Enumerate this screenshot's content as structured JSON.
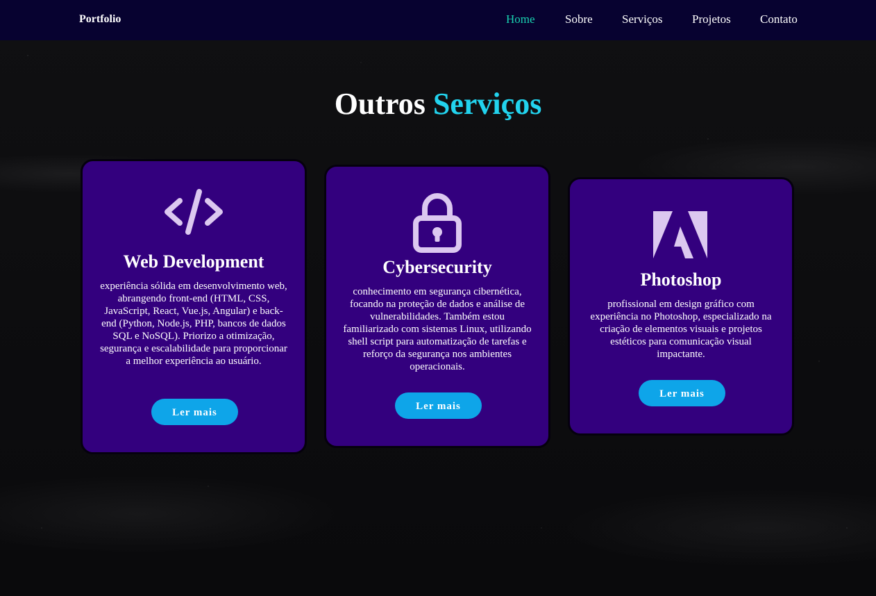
{
  "nav": {
    "logo": "Portfolio",
    "links": [
      {
        "label": "Home",
        "active": true
      },
      {
        "label": "Sobre",
        "active": false
      },
      {
        "label": "Serviços",
        "active": false
      },
      {
        "label": "Projetos",
        "active": false
      },
      {
        "label": "Contato",
        "active": false
      }
    ]
  },
  "section": {
    "title_white": "Outros",
    "title_accent": "Serviços"
  },
  "cards": [
    {
      "icon": "code-icon",
      "title": "Web Development",
      "text": "experiência sólida em desenvolvimento web, abrangendo front-end (HTML, CSS, JavaScript, React, Vue.js, Angular) e back-end (Python, Node.js, PHP, bancos de dados SQL e NoSQL). Priorizo a otimização, segurança e escalabilidade para proporcionar a melhor experiência ao usuário.",
      "button": "Ler mais"
    },
    {
      "icon": "lock-icon",
      "title": "Cybersecurity",
      "text": "conhecimento em segurança cibernética, focando na proteção de dados e análise de vulnerabilidades. Também estou familiarizado com sistemas Linux, utilizando shell script para automatização de tarefas e reforço da segurança nos ambientes operacionais.",
      "button": "Ler mais"
    },
    {
      "icon": "adobe-icon",
      "title": "Photoshop",
      "text": "profissional em design gráfico com experiência no Photoshop, especializado na criação de elementos visuais e projetos estéticos para comunicação visual impactante.",
      "button": "Ler mais"
    }
  ],
  "colors": {
    "navbar_bg": "#070230",
    "nav_active": "#19d3b1",
    "title_accent": "#22d3ee",
    "card_bg": "#33007e",
    "button_bg": "#0ea5e9",
    "icon_color": "#dcc8f0"
  }
}
